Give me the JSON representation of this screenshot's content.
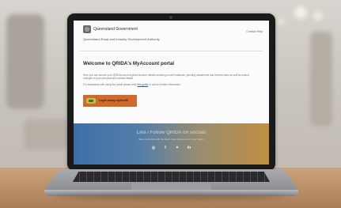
{
  "portal": {
    "government": "Queensland Government",
    "authority": "Queensland Rural and Industry Development Authority",
    "header_links": "Contact  Help",
    "welcome_title": "Welcome to QRIDA's MyAccount portal",
    "intro_text": "Here you can access your QRIDA loan and grant account details including current balances, pending instalments and interest rates as well as submit changes to your personal and contact details.",
    "help_text_before": "For assistance with using the portal please refer ",
    "help_link": "this guide",
    "help_text_after": " or call for further information.",
    "login_button": "Login using myGovID"
  },
  "social_band": {
    "title": "Like / Follow QRIDA on socials",
    "subtitle": "Stay connected with the latest news and events in your region",
    "icons": [
      "instagram-icon",
      "facebook-icon",
      "twitter-icon",
      "linkedin-icon"
    ]
  },
  "colors": {
    "login_button": "#cf6a2a",
    "band_left": "#3d6fa8",
    "band_right": "#c08f44",
    "table": "#b98e66"
  }
}
